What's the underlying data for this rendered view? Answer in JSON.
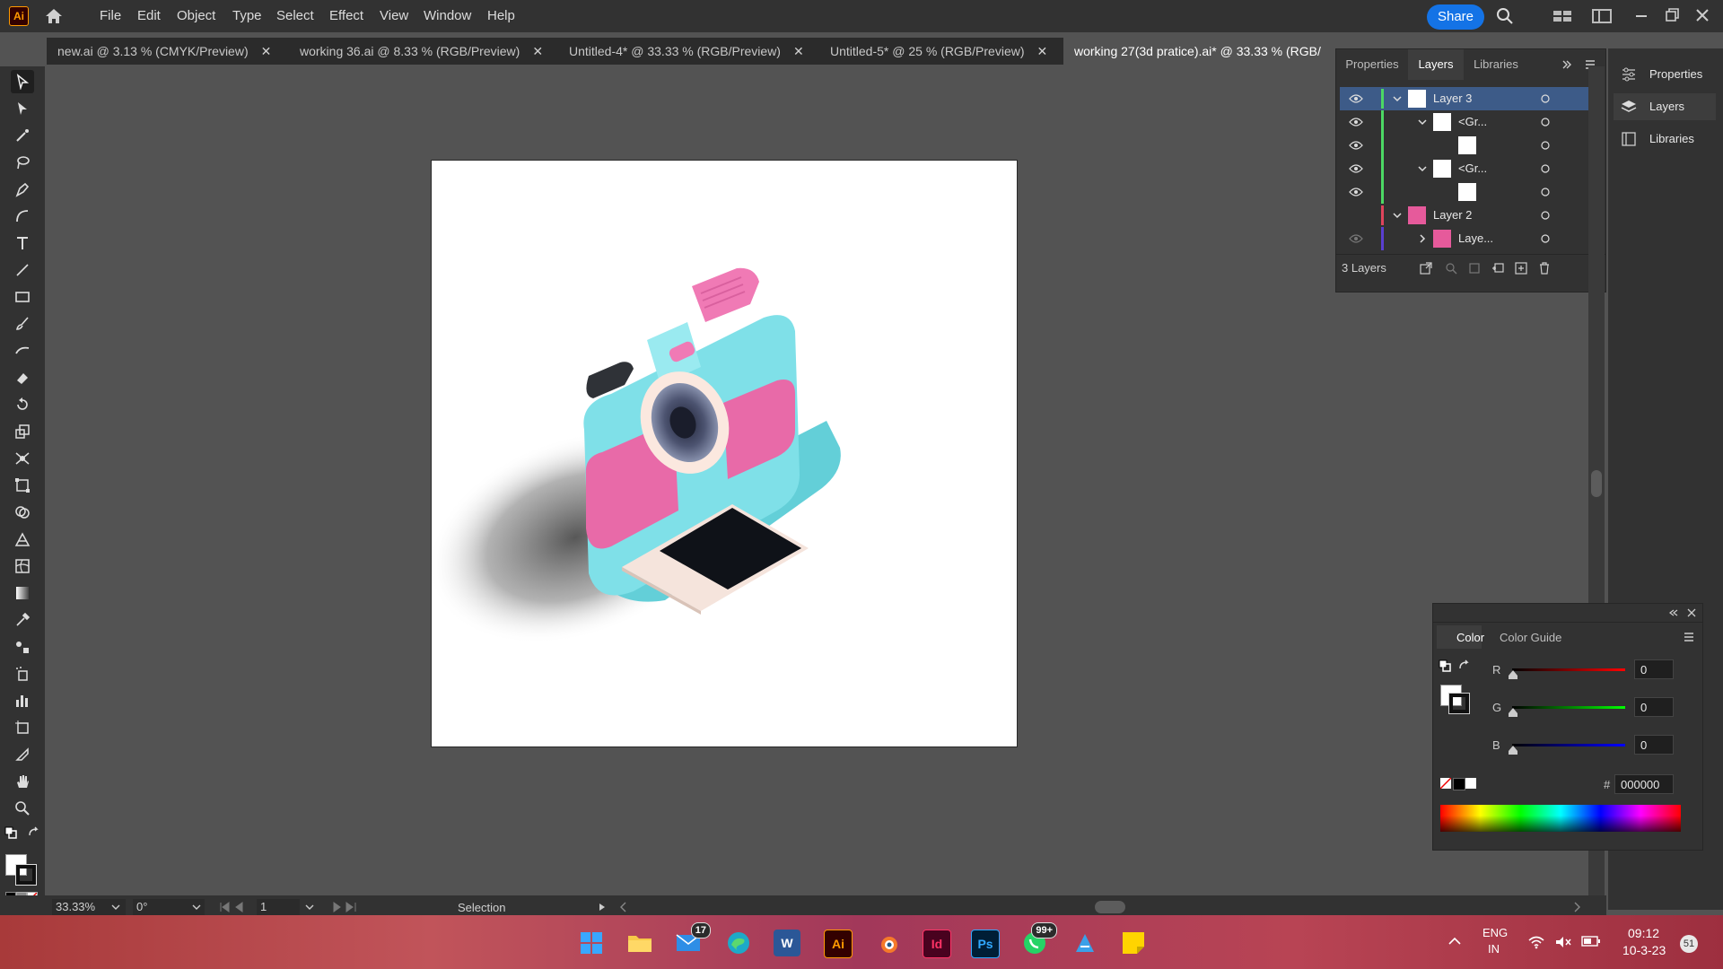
{
  "app": {
    "logo": "Ai",
    "name": "Adobe Illustrator"
  },
  "menu": [
    "File",
    "Edit",
    "Object",
    "Type",
    "Select",
    "Effect",
    "View",
    "Window",
    "Help"
  ],
  "share_label": "Share",
  "tabs": [
    {
      "label": "new.ai @ 3.13 % (CMYK/Preview)"
    },
    {
      "label": "working 36.ai @ 8.33 % (RGB/Preview)"
    },
    {
      "label": "Untitled-4* @ 33.33 % (RGB/Preview)"
    },
    {
      "label": "Untitled-5* @ 25 % (RGB/Preview)"
    },
    {
      "label": "working 27(3d pratice).ai* @ 33.33 % (RGB/"
    }
  ],
  "layers_panel": {
    "tabs": [
      "Properties",
      "Layers",
      "Libraries"
    ],
    "rows": [
      {
        "name": "Layer 3"
      },
      {
        "name": "<Gr..."
      },
      {
        "name": ""
      },
      {
        "name": "<Gr..."
      },
      {
        "name": ""
      },
      {
        "name": "Layer 2"
      },
      {
        "name": "Laye..."
      }
    ],
    "count_label": "3 Layers"
  },
  "right_dock": {
    "items": [
      "Properties",
      "Layers",
      "Libraries"
    ]
  },
  "color_panel": {
    "tabs": [
      "Color",
      "Color Guide"
    ],
    "r_label": "R",
    "g_label": "G",
    "b_label": "B",
    "r": "0",
    "g": "0",
    "b": "0",
    "hash": "#",
    "hex": "000000"
  },
  "status": {
    "zoom": "33.33%",
    "rotation": "0°",
    "artboard": "1",
    "tool": "Selection"
  },
  "taskbar": {
    "badge_mail": "17",
    "badge_whatsapp": "99+",
    "tb_ai": "Ai",
    "tb_id": "Id",
    "tb_ps": "Ps",
    "tb_w": "W",
    "lang1": "ENG",
    "lang2": "IN",
    "time": "09:12",
    "date": "10-3-23",
    "notif": "51"
  },
  "colors": {
    "accent": "#1473e6",
    "illustrator": "#ff9a00",
    "layer3": "#4cd964",
    "layer2": "#e0445c"
  }
}
